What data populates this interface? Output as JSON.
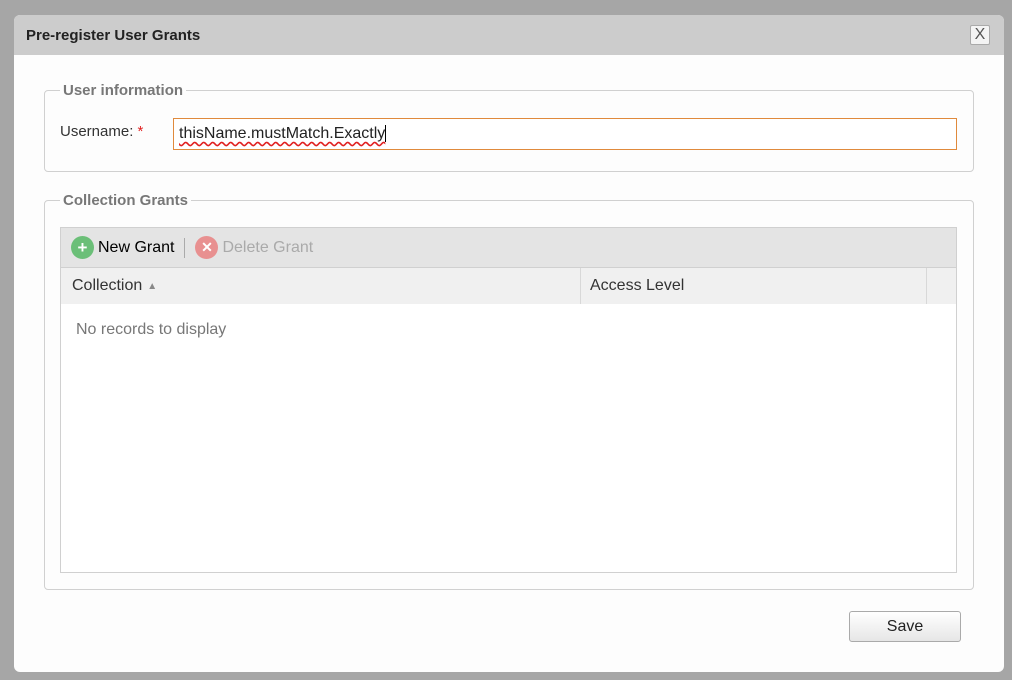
{
  "dialog": {
    "title": "Pre-register User Grants",
    "close_label": "X"
  },
  "user_info": {
    "legend": "User information",
    "username_label": "Username:",
    "required_mark": "*",
    "username_value": "thisName.mustMatch.Exactly"
  },
  "grants": {
    "legend": "Collection Grants",
    "new_grant": "New Grant",
    "delete_grant": "Delete Grant",
    "columns": [
      "Collection",
      "Access Level"
    ],
    "sort_indicator": "▲",
    "empty_text": "No records to display"
  },
  "footer": {
    "save_label": "Save"
  }
}
